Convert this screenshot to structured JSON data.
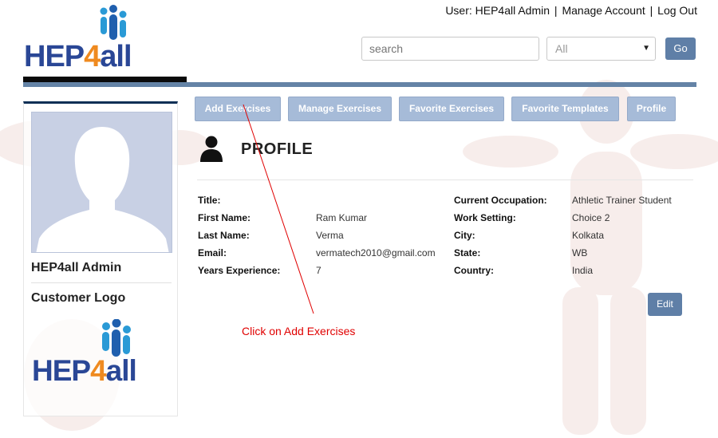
{
  "header": {
    "user_text": "User: HEP4all Admin",
    "manage_account": "Manage Account",
    "log_out": "Log Out",
    "separator": "|"
  },
  "logo": {
    "text_blue": "HEP",
    "text_orange": "4",
    "text_blue2": "all"
  },
  "search": {
    "placeholder": "search",
    "category": "All",
    "go_label": "Go"
  },
  "sidebar": {
    "user_name": "HEP4all Admin",
    "customer_logo_label": "Customer Logo"
  },
  "nav": {
    "add_exercises": "Add Exercises",
    "manage_exercises": "Manage Exercises",
    "favorite_exercises": "Favorite Exercises",
    "favorite_templates": "Favorite Templates",
    "profile": "Profile"
  },
  "profile": {
    "heading": "PROFILE",
    "left": [
      {
        "label": "Title:",
        "value": ""
      },
      {
        "label": "First Name:",
        "value": "Ram Kumar"
      },
      {
        "label": "Last Name:",
        "value": "Verma"
      },
      {
        "label": "Email:",
        "value": "vermatech2010@gmail.com"
      },
      {
        "label": "Years Experience:",
        "value": "7"
      }
    ],
    "right": [
      {
        "label": "Current Occupation:",
        "value": "Athletic Trainer Student"
      },
      {
        "label": "Work Setting:",
        "value": "Choice 2"
      },
      {
        "label": "City:",
        "value": "Kolkata"
      },
      {
        "label": "State:",
        "value": "WB"
      },
      {
        "label": "Country:",
        "value": "India"
      }
    ],
    "edit_label": "Edit"
  },
  "annotation": {
    "text": "Click on Add Exercises",
    "color": "#e00000"
  },
  "colors": {
    "accent": "#6483a6",
    "nav_button": "#a6bbd8",
    "brand_blue": "#2a4796",
    "brand_orange": "#ef8a1f"
  }
}
